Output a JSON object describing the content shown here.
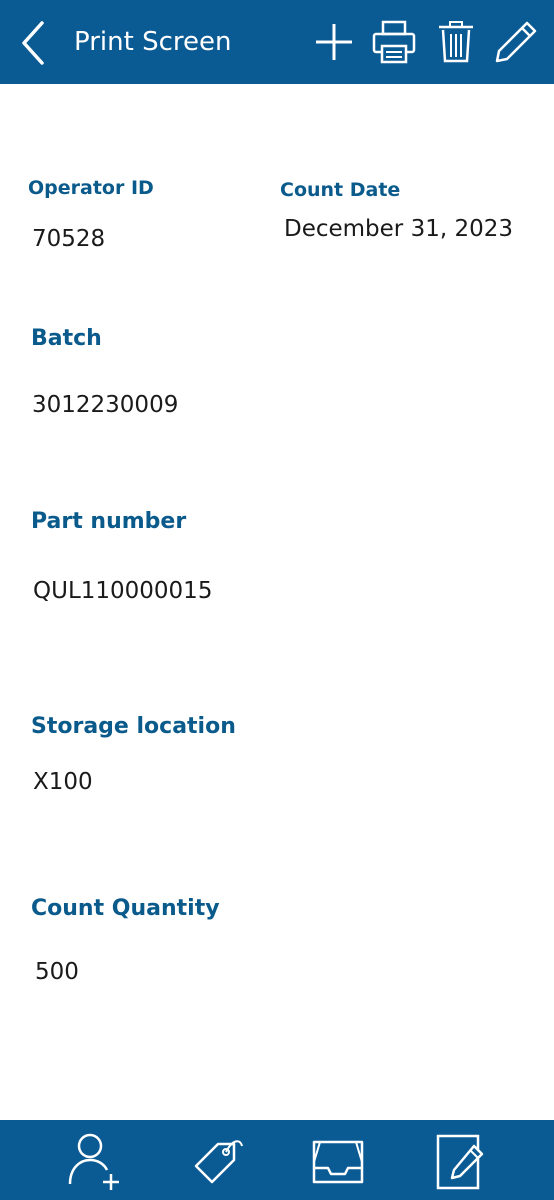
{
  "header": {
    "title": "Print Screen",
    "back_icon": "chevron-left-icon",
    "actions": [
      {
        "name": "add-button",
        "icon": "plus-icon"
      },
      {
        "name": "print-button",
        "icon": "printer-icon"
      },
      {
        "name": "delete-button",
        "icon": "trash-icon"
      },
      {
        "name": "edit-button",
        "icon": "pencil-icon"
      }
    ]
  },
  "fields": {
    "operator_id": {
      "label": "Operator ID",
      "value": "70528"
    },
    "count_date": {
      "label": "Count Date",
      "value": "December 31, 2023"
    },
    "batch": {
      "label": "Batch",
      "value": "3012230009"
    },
    "part_number": {
      "label": "Part number",
      "value": "QUL110000015"
    },
    "storage_location": {
      "label": "Storage location",
      "value": "X100"
    },
    "count_quantity": {
      "label": "Count Quantity",
      "value": "500"
    }
  },
  "footer": {
    "items": [
      {
        "name": "add-user",
        "icon": "user-plus-icon"
      },
      {
        "name": "tag",
        "icon": "tag-icon"
      },
      {
        "name": "inbox",
        "icon": "inbox-tray-icon"
      },
      {
        "name": "edit-note",
        "icon": "note-edit-icon"
      }
    ]
  },
  "colors": {
    "brand": "#0a5a94",
    "label": "#0a5a8c",
    "text": "#1a1a1a",
    "background": "#ffffff"
  }
}
